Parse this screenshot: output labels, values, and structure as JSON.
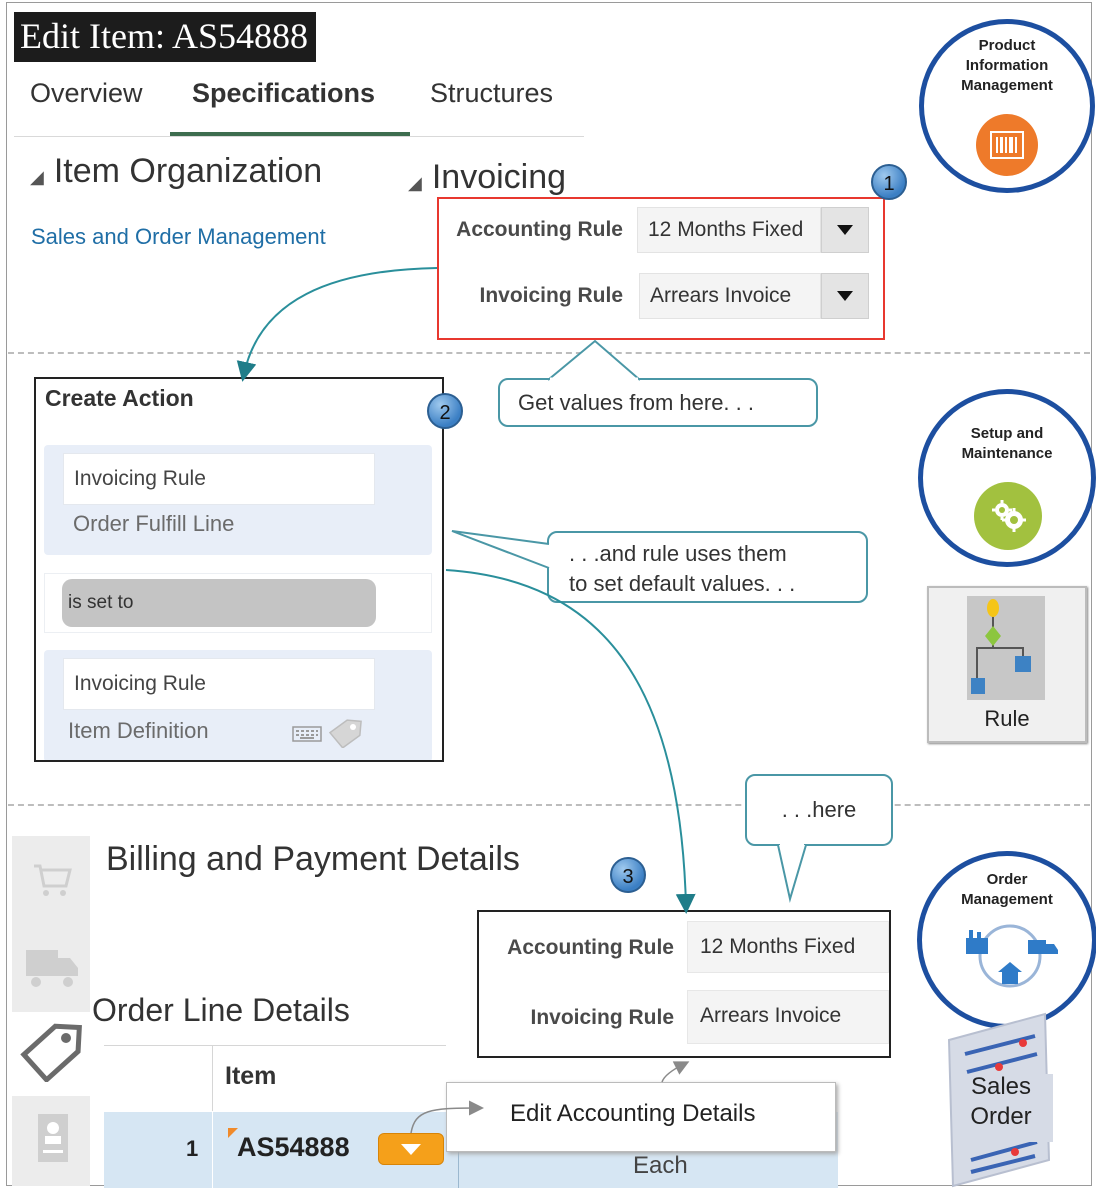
{
  "header": {
    "title": "Edit Item: AS54888",
    "tabs": [
      {
        "label": "Overview",
        "active": false
      },
      {
        "label": "Specifications",
        "active": true
      },
      {
        "label": "Structures",
        "active": false
      }
    ]
  },
  "item_org": {
    "title": "Item Organization",
    "link": "Sales and Order Management"
  },
  "invoicing": {
    "title": "Invoicing",
    "accounting_rule_label": "Accounting Rule",
    "accounting_rule_value": "12 Months Fixed",
    "invoicing_rule_label": "Invoicing Rule",
    "invoicing_rule_value": "Arrears Invoice"
  },
  "badges": [
    "1",
    "2",
    "3"
  ],
  "callouts": {
    "get_values": "Get values  from here. . .",
    "rule_line1": ". . .and rule uses them",
    "rule_line2": "to set default values. . .",
    "here": ". . .here"
  },
  "create_action": {
    "title": "Create Action",
    "field1": "Invoicing Rule",
    "sub1": "Order Fulfill Line",
    "operator": "is set to",
    "field2": "Invoicing Rule",
    "sub2": "Item Definition"
  },
  "apps": {
    "pim": [
      "Product",
      "Information",
      "Management"
    ],
    "setup": [
      "Setup and",
      "Maintenance"
    ],
    "rule": "Rule",
    "order": [
      "Order",
      "Management"
    ],
    "sales_order": [
      "Sales",
      "Order"
    ]
  },
  "billing": {
    "title": "Billing and Payment Details",
    "accounting_rule_label": "Accounting Rule",
    "accounting_rule_value": "12 Months Fixed",
    "invoicing_rule_label": "Invoicing Rule",
    "invoicing_rule_value": "Arrears Invoice"
  },
  "order_lines": {
    "title": "Order Line Details",
    "column_item": "Item",
    "row_num": "1",
    "row_item": "AS54888",
    "row_uom_partial": "Each",
    "menu_item": "Edit Accounting Details"
  },
  "colors": {
    "accent_teal": "#4a97a6",
    "highlight_red": "#e8382f",
    "app_circle_blue": "#1d4fa0",
    "orange": "#f5a01a"
  }
}
